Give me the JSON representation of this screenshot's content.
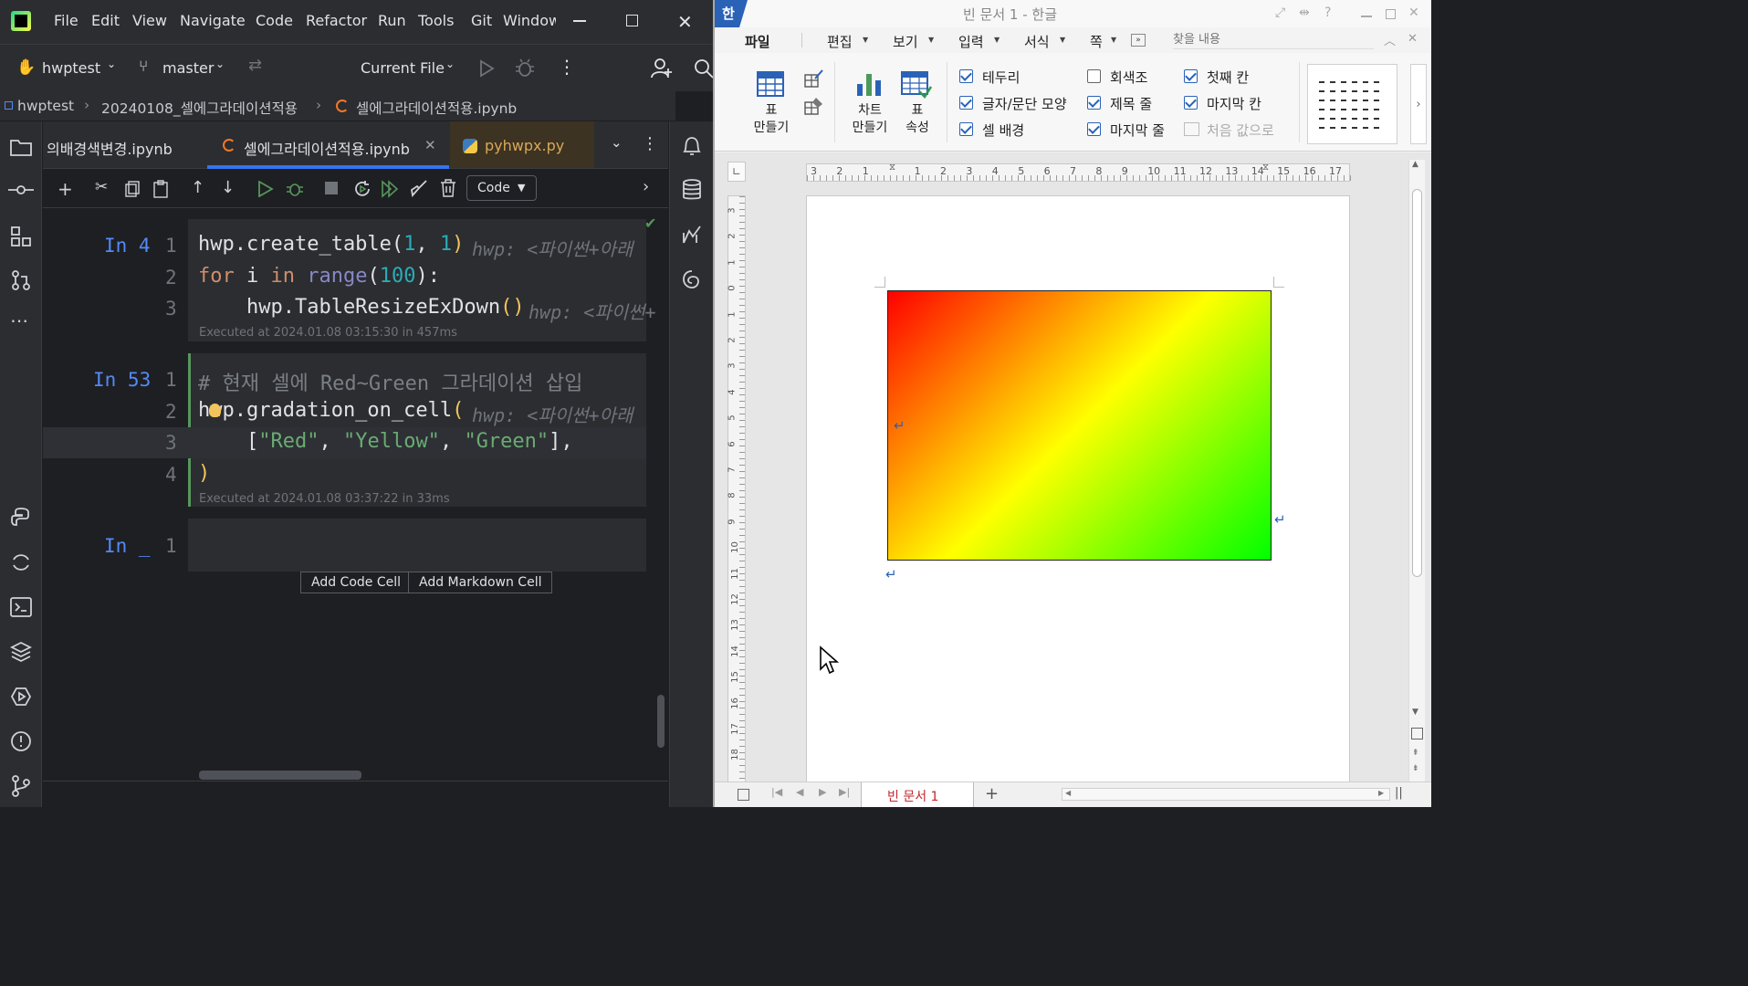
{
  "ide": {
    "menu": [
      "File",
      "Edit",
      "View",
      "Navigate",
      "Code",
      "Refactor",
      "Run",
      "Tools",
      "Git",
      "Window"
    ],
    "project": "hwptest",
    "branch": "master",
    "run_config": "Current File",
    "breadcrumb": [
      "hwptest",
      "20240108_셀에그라데이션적용",
      "셀에그라데이션적용.ipynb"
    ],
    "tabs": [
      {
        "label": "의배경색변경.ipynb",
        "active": false
      },
      {
        "label": "셀에그라데이션적용.ipynb",
        "active": true
      },
      {
        "label": "pyhwpx.py",
        "active": false
      }
    ],
    "cell_type": "Code",
    "cells": [
      {
        "label": "In 4",
        "lines": [
          {
            "n": "1",
            "text": "hwp.create_table(1, 1)",
            "hint": "hwp: <파이썬+아래"
          },
          {
            "n": "2",
            "text": "for i in range(100):",
            "hint": ""
          },
          {
            "n": "3",
            "text": "    hwp.TableResizeExDown()",
            "hint": "hwp: <파이썬+"
          }
        ],
        "executed": "Executed at 2024.01.08 03:15:30 in 457ms"
      },
      {
        "label": "In 53",
        "lines": [
          {
            "n": "1",
            "text": "# 현재 셀에 Red~Green 그라데이션 삽입",
            "hint": ""
          },
          {
            "n": "2",
            "text": "hwp.gradation_on_cell(",
            "hint": "hwp: <파이썬+아래"
          },
          {
            "n": "3",
            "text": "    [\"Red\", \"Yellow\", \"Green\"],",
            "hint": ""
          },
          {
            "n": "4",
            "text": ")",
            "hint": ""
          }
        ],
        "executed": "Executed at 2024.01.08 03:37:22 in 33ms"
      },
      {
        "label": "In _",
        "lines": [
          {
            "n": "1",
            "text": "",
            "hint": ""
          }
        ],
        "executed": ""
      }
    ],
    "add_code": "Add Code Cell",
    "add_markdown": "Add Markdown Cell"
  },
  "hwp": {
    "title": "빈 문서 1 - 한글",
    "menu": [
      "파일",
      "편집",
      "보기",
      "입력",
      "서식",
      "쪽"
    ],
    "search_placeholder": "찾을 내용",
    "ribbon": {
      "table_make": "표\n만들기",
      "chart_make": "차트\n만들기",
      "table_props": "표\n속성",
      "checks": [
        {
          "label": "테두리",
          "checked": true
        },
        {
          "label": "글자/문단 모양",
          "checked": true
        },
        {
          "label": "셀 배경",
          "checked": true
        },
        {
          "label": "회색조",
          "checked": false
        },
        {
          "label": "제목 줄",
          "checked": true
        },
        {
          "label": "마지막 줄",
          "checked": true
        },
        {
          "label": "첫째 칸",
          "checked": true
        },
        {
          "label": "마지막 칸",
          "checked": true
        },
        {
          "label": "처음 값으로",
          "checked": false
        }
      ]
    },
    "ruler_h": [
      "3",
      "2",
      "1",
      "",
      "1",
      "2",
      "3",
      "4",
      "5",
      "6",
      "7",
      "8",
      "9",
      "10",
      "11",
      "12",
      "13",
      "14",
      "15",
      "16",
      "17"
    ],
    "ruler_v": [
      "3",
      "2",
      "1",
      "0",
      "1",
      "2",
      "3",
      "4",
      "5",
      "6",
      "7",
      "8",
      "9",
      "10",
      "11",
      "12",
      "13",
      "14",
      "15",
      "16",
      "17",
      "18"
    ],
    "doc_tab": "빈 문서 1",
    "gradient_colors": [
      "Red",
      "Yellow",
      "Green"
    ]
  }
}
